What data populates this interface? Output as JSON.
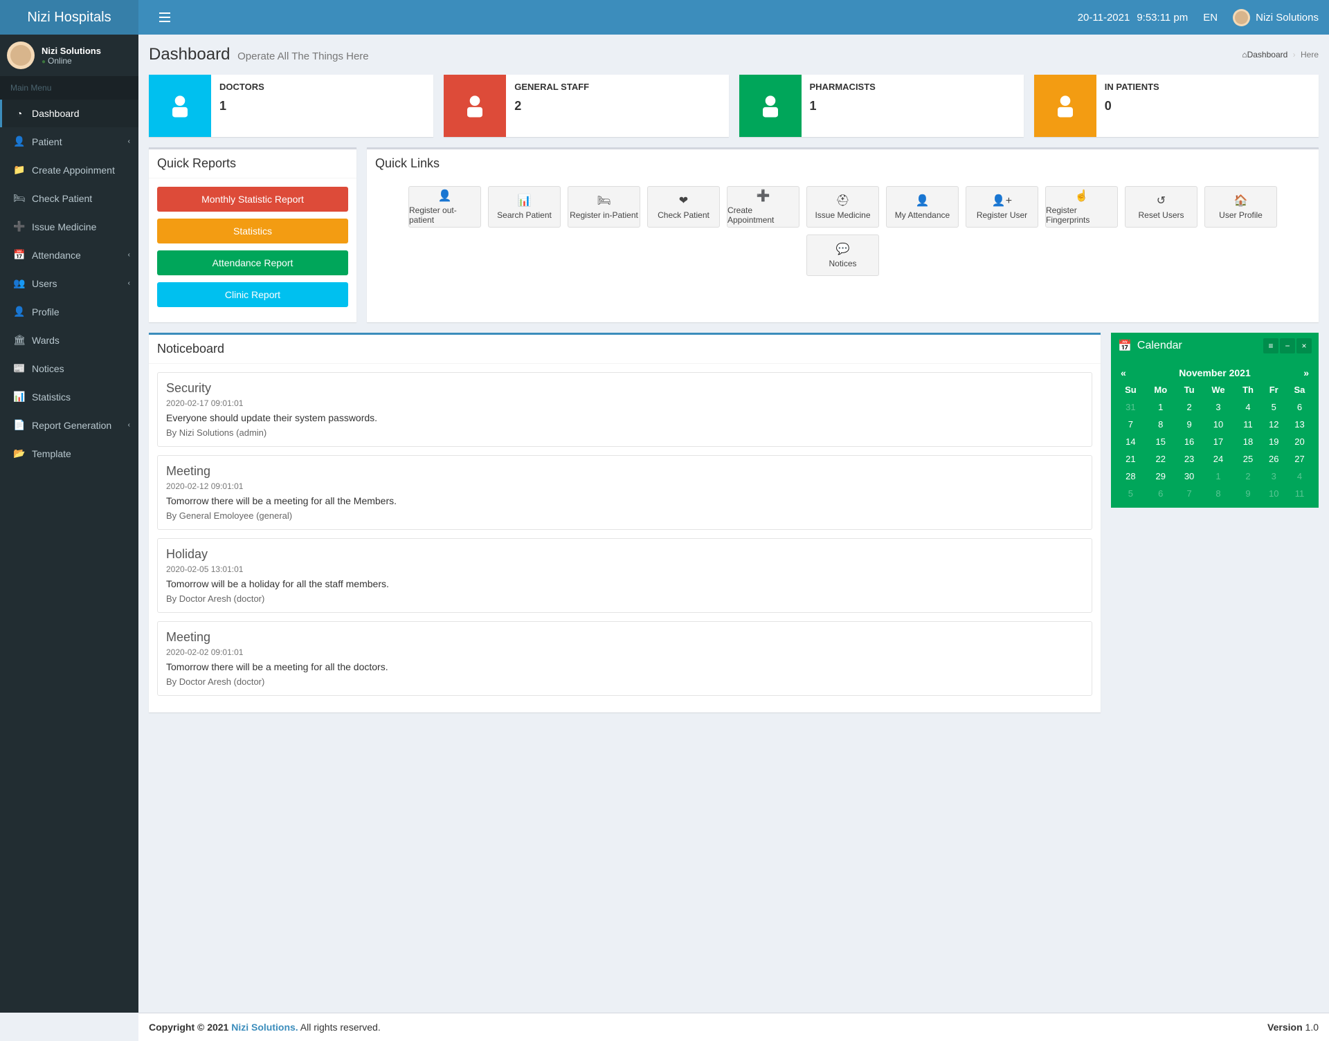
{
  "brand": "Nizi Hospitals",
  "header": {
    "date": "20-11-2021",
    "time": "9:53:11 pm",
    "lang": "EN",
    "username": "Nizi Solutions"
  },
  "sidebar": {
    "user": {
      "name": "Nizi Solutions",
      "status": "Online"
    },
    "section": "Main Menu",
    "items": [
      {
        "label": "Dashboard",
        "icon": "tachometer-icon",
        "active": true
      },
      {
        "label": "Patient",
        "icon": "user-icon",
        "expandable": true
      },
      {
        "label": "Create Appoinment",
        "icon": "folder-plus-icon"
      },
      {
        "label": "Check Patient",
        "icon": "bed-icon"
      },
      {
        "label": "Issue Medicine",
        "icon": "plus-square-icon"
      },
      {
        "label": "Attendance",
        "icon": "calendar-icon",
        "expandable": true
      },
      {
        "label": "Users",
        "icon": "users-icon",
        "expandable": true
      },
      {
        "label": "Profile",
        "icon": "user-icon"
      },
      {
        "label": "Wards",
        "icon": "building-icon"
      },
      {
        "label": "Notices",
        "icon": "notice-icon"
      },
      {
        "label": "Statistics",
        "icon": "chart-icon"
      },
      {
        "label": "Report Generation",
        "icon": "report-icon",
        "expandable": true
      },
      {
        "label": "Template",
        "icon": "folder-icon"
      }
    ]
  },
  "page": {
    "title": "Dashboard",
    "subtitle": "Operate All The Things Here",
    "crumb_root": "Dashboard",
    "crumb_here": "Here"
  },
  "stats": [
    {
      "title": "DOCTORS",
      "value": "1",
      "color": "bg-aqua",
      "icon": "doctor-icon"
    },
    {
      "title": "GENERAL STAFF",
      "value": "2",
      "color": "bg-red",
      "icon": "id-card-icon"
    },
    {
      "title": "PHARMACISTS",
      "value": "1",
      "color": "bg-green",
      "icon": "medkit-icon"
    },
    {
      "title": "IN PATIENTS",
      "value": "0",
      "color": "bg-yellow",
      "icon": "patient-icon"
    }
  ],
  "quick_reports": {
    "title": "Quick Reports",
    "buttons": [
      {
        "label": "Monthly Statistic Report",
        "class": "btn-danger"
      },
      {
        "label": "Statistics",
        "class": "btn-warning"
      },
      {
        "label": "Attendance Report",
        "class": "btn-success"
      },
      {
        "label": "Clinic Report",
        "class": "btn-info"
      }
    ]
  },
  "quick_links": {
    "title": "Quick Links",
    "items": [
      {
        "label": "Register out-patient",
        "icon": "user-icon"
      },
      {
        "label": "Search Patient",
        "icon": "chart-icon"
      },
      {
        "label": "Register in-Patient",
        "icon": "bed-icon"
      },
      {
        "label": "Check Patient",
        "icon": "heartbeat-icon"
      },
      {
        "label": "Create Appointment",
        "icon": "plus-square-icon"
      },
      {
        "label": "Issue Medicine",
        "icon": "medkit-icon"
      },
      {
        "label": "My Attendance",
        "icon": "user-icon"
      },
      {
        "label": "Register User",
        "icon": "user-plus-icon"
      },
      {
        "label": "Register Fingerprints",
        "icon": "fingerprint-icon"
      },
      {
        "label": "Reset Users",
        "icon": "user-reset-icon"
      },
      {
        "label": "User Profile",
        "icon": "home-icon"
      },
      {
        "label": "Notices",
        "icon": "comment-icon"
      }
    ]
  },
  "noticeboard": {
    "title": "Noticeboard",
    "items": [
      {
        "title": "Security",
        "ts": "2020-02-17 09:01:01",
        "msg": "Everyone should update their system passwords.",
        "by": "By Nizi Solutions (admin)"
      },
      {
        "title": "Meeting",
        "ts": "2020-02-12 09:01:01",
        "msg": "Tomorrow there will be a meeting for all the Members.",
        "by": "By General Emoloyee (general)"
      },
      {
        "title": "Holiday",
        "ts": "2020-02-05 13:01:01",
        "msg": "Tomorrow will be a holiday for all the staff members.",
        "by": "By Doctor Aresh (doctor)"
      },
      {
        "title": "Meeting",
        "ts": "2020-02-02 09:01:01",
        "msg": "Tomorrow there will be a meeting for all the doctors.",
        "by": "By Doctor Aresh (doctor)"
      }
    ]
  },
  "calendar": {
    "title": "Calendar",
    "month": "November 2021",
    "dow": [
      "Su",
      "Mo",
      "Tu",
      "We",
      "Th",
      "Fr",
      "Sa"
    ],
    "weeks": [
      [
        {
          "d": "31",
          "o": true
        },
        {
          "d": "1"
        },
        {
          "d": "2"
        },
        {
          "d": "3"
        },
        {
          "d": "4"
        },
        {
          "d": "5"
        },
        {
          "d": "6"
        }
      ],
      [
        {
          "d": "7"
        },
        {
          "d": "8"
        },
        {
          "d": "9"
        },
        {
          "d": "10"
        },
        {
          "d": "11"
        },
        {
          "d": "12"
        },
        {
          "d": "13"
        }
      ],
      [
        {
          "d": "14"
        },
        {
          "d": "15"
        },
        {
          "d": "16"
        },
        {
          "d": "17"
        },
        {
          "d": "18"
        },
        {
          "d": "19"
        },
        {
          "d": "20"
        }
      ],
      [
        {
          "d": "21"
        },
        {
          "d": "22"
        },
        {
          "d": "23"
        },
        {
          "d": "24"
        },
        {
          "d": "25"
        },
        {
          "d": "26"
        },
        {
          "d": "27"
        }
      ],
      [
        {
          "d": "28"
        },
        {
          "d": "29"
        },
        {
          "d": "30"
        },
        {
          "d": "1",
          "o": true
        },
        {
          "d": "2",
          "o": true
        },
        {
          "d": "3",
          "o": true
        },
        {
          "d": "4",
          "o": true
        }
      ],
      [
        {
          "d": "5",
          "o": true
        },
        {
          "d": "6",
          "o": true
        },
        {
          "d": "7",
          "o": true
        },
        {
          "d": "8",
          "o": true
        },
        {
          "d": "9",
          "o": true
        },
        {
          "d": "10",
          "o": true
        },
        {
          "d": "11",
          "o": true
        }
      ]
    ]
  },
  "footer": {
    "copyright_prefix": "Copyright © 2021 ",
    "company": "Nizi Solutions.",
    "rights": " All rights reserved.",
    "version_label": "Version",
    "version": " 1.0"
  }
}
